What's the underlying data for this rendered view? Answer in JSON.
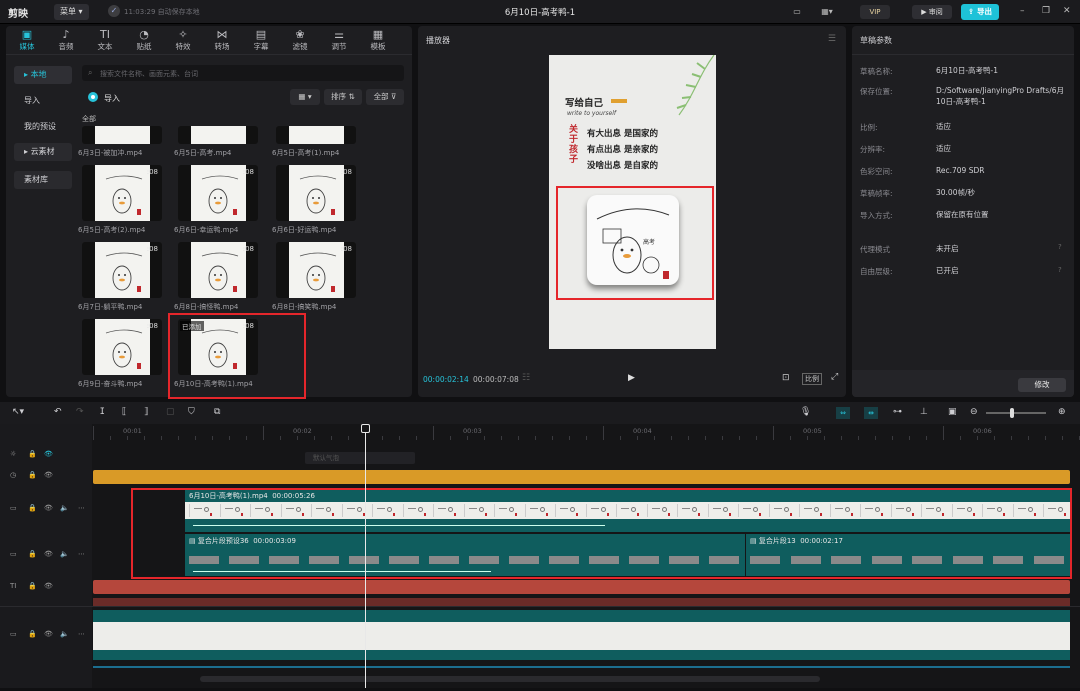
{
  "titlebar": {
    "app_name": "剪映",
    "menu_label": "菜单",
    "save_status": "11:03:29 自动保存本地",
    "project_title": "6月10日-高考鸭-1",
    "vip_label": "VIP",
    "review_label": "审阅",
    "export_label": "导出"
  },
  "media_tabs": [
    {
      "label": "媒体",
      "icon": "▣"
    },
    {
      "label": "音频",
      "icon": "♪"
    },
    {
      "label": "文本",
      "icon": "TI"
    },
    {
      "label": "贴纸",
      "icon": "◔"
    },
    {
      "label": "特效",
      "icon": "✧"
    },
    {
      "label": "转场",
      "icon": "⋈"
    },
    {
      "label": "字幕",
      "icon": "▤"
    },
    {
      "label": "滤镜",
      "icon": "❀"
    },
    {
      "label": "调节",
      "icon": "⚌"
    },
    {
      "label": "模板",
      "icon": "▦"
    }
  ],
  "sidebar": {
    "local": "本地",
    "import": "导入",
    "presets": "我的预设",
    "cloud": "云素材",
    "library": "素材库"
  },
  "media": {
    "search_placeholder": "搜索文件名称、画面元素、台词",
    "import_label": "导入",
    "sort_label": "排序",
    "filter_label": "全部",
    "all_header": "全部",
    "added_badge": "已添加",
    "items": [
      {
        "name": "6月3日-被加冲.mp4",
        "dur": ""
      },
      {
        "name": "6月5日-高考.mp4",
        "dur": ""
      },
      {
        "name": "6月5日-高考(1).mp4",
        "dur": ""
      },
      {
        "name": "6月5日-高考(2).mp4",
        "dur": ":08"
      },
      {
        "name": "6月6日-幸运鸭.mp4",
        "dur": ":08"
      },
      {
        "name": "6月6日-好运鸭.mp4",
        "dur": ":08"
      },
      {
        "name": "6月7日-躺平鸭.mp4",
        "dur": ":08"
      },
      {
        "name": "6月8日-搞怪鸭.mp4",
        "dur": ":08"
      },
      {
        "name": "6月8日-搞笑鸭.mp4",
        "dur": ":08"
      },
      {
        "name": "6月9日-奋斗鸭.mp4",
        "dur": ":08"
      },
      {
        "name": "6月10日-高考鸭(1).mp4",
        "dur": ":08"
      }
    ]
  },
  "player": {
    "title": "播放器",
    "time_current": "00:00:02:14",
    "time_total": "00:00:07:08",
    "ratio_label": "比例",
    "preview": {
      "heading": "写给自己",
      "sub": "write to yourself",
      "side": "关于孩子",
      "line1": "有大出息 是国家的",
      "line2": "有点出息 是亲家的",
      "line3": "没啥出息 是自家的",
      "card_text": "高考"
    }
  },
  "params": {
    "title": "草稿参数",
    "rows": [
      {
        "key": "草稿名称:",
        "val": "6月10日-高考鸭-1"
      },
      {
        "key": "保存位置:",
        "val": "D:/Software/JianyingPro Drafts/6月10日-高考鸭-1"
      },
      {
        "key": "比例:",
        "val": "适应"
      },
      {
        "key": "分辨率:",
        "val": "适应"
      },
      {
        "key": "色彩空间:",
        "val": "Rec.709 SDR"
      },
      {
        "key": "草稿帧率:",
        "val": "30.00帧/秒"
      },
      {
        "key": "导入方式:",
        "val": "保留在原有位置"
      },
      {
        "key": "代理模式",
        "val": "未开启"
      },
      {
        "key": "自由层级:",
        "val": "已开启"
      }
    ],
    "modify_label": "修改"
  },
  "timeline": {
    "ruler": [
      "00:01",
      "00:02",
      "00:03",
      "00:04",
      "00:05",
      "00:06"
    ],
    "ghost_clip": "默认气泡",
    "main_clip": {
      "name": "6月10日-高考鸭(1).mp4",
      "dur": "00:00:05:26"
    },
    "comp1": {
      "name": "复合片段预设36",
      "dur": "00:00:03:09"
    },
    "comp2": {
      "name": "复合片段13",
      "dur": "00:00:02:17"
    }
  },
  "colors": {
    "accent": "#27c3d9",
    "highlight": "#e5262b",
    "orange": "#d99a27"
  }
}
